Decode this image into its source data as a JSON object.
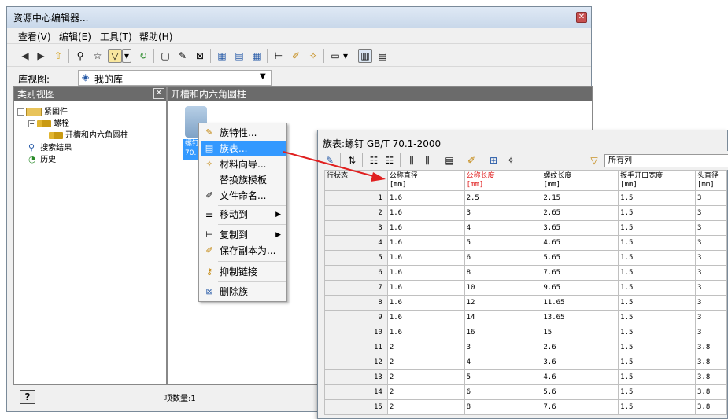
{
  "main_window": {
    "title": "资源中心编辑器...",
    "menu": [
      "查看(V)",
      "编辑(E)",
      "工具(T)",
      "帮助(H)"
    ],
    "library_label": "库视图:",
    "library_value": "我的库",
    "tree_panel_title": "类别视图",
    "content_panel_title": "开槽和内六角圆柱",
    "tree": [
      {
        "label": "紧固件",
        "level": 0,
        "expander": "⊟"
      },
      {
        "label": "螺栓",
        "level": 1,
        "expander": "⊟"
      },
      {
        "label": "开槽和内六角圆柱",
        "level": 2,
        "expander": ""
      },
      {
        "label": "搜索结果",
        "level": 0,
        "expander": ""
      },
      {
        "label": "历史",
        "level": 0,
        "expander": ""
      }
    ],
    "item_caption": [
      "螺钉",
      "70."
    ],
    "status": "项数量:1",
    "help_button": "?"
  },
  "context_menu": {
    "items": [
      {
        "label": "族特性...",
        "icon": "family-properties-icon",
        "submenu": false
      },
      {
        "label": "族表...",
        "icon": "family-table-icon",
        "submenu": false,
        "selected": true
      },
      {
        "label": "材料向导...",
        "icon": "material-wizard-icon",
        "submenu": false
      },
      {
        "label": "替换族模板",
        "icon": "",
        "submenu": false
      },
      {
        "label": "文件命名...",
        "icon": "file-naming-icon",
        "submenu": false
      },
      {
        "label": "移动到",
        "icon": "move-to-icon",
        "submenu": true
      },
      {
        "label": "复制到",
        "icon": "copy-to-icon",
        "submenu": true
      },
      {
        "label": "保存副本为...",
        "icon": "save-copy-icon",
        "submenu": false
      },
      {
        "label": "抑制链接",
        "icon": "suppress-link-icon",
        "submenu": false
      },
      {
        "label": "删除族",
        "icon": "delete-family-icon",
        "submenu": false
      }
    ]
  },
  "family_table": {
    "title": "族表:螺钉 GB/T 70.1-2000",
    "filter_value": "所有列",
    "columns": [
      {
        "name": "行状态",
        "unit": ""
      },
      {
        "name": "公称直径",
        "unit": "[mm]",
        "required": false
      },
      {
        "name": "公称长度",
        "unit": "[mm]",
        "required": true
      },
      {
        "name": "螺纹长度",
        "unit": "[mm]",
        "required": false
      },
      {
        "name": "扳手开口宽度",
        "unit": "[mm]",
        "required": false
      },
      {
        "name": "头直径",
        "unit": "[mm]",
        "required": false
      }
    ],
    "rows": [
      [
        "1",
        "1.6",
        "2.5",
        "2.15",
        "1.5",
        "3"
      ],
      [
        "2",
        "1.6",
        "3",
        "2.65",
        "1.5",
        "3"
      ],
      [
        "3",
        "1.6",
        "4",
        "3.65",
        "1.5",
        "3"
      ],
      [
        "4",
        "1.6",
        "5",
        "4.65",
        "1.5",
        "3"
      ],
      [
        "5",
        "1.6",
        "6",
        "5.65",
        "1.5",
        "3"
      ],
      [
        "6",
        "1.6",
        "8",
        "7.65",
        "1.5",
        "3"
      ],
      [
        "7",
        "1.6",
        "10",
        "9.65",
        "1.5",
        "3"
      ],
      [
        "8",
        "1.6",
        "12",
        "11.65",
        "1.5",
        "3"
      ],
      [
        "9",
        "1.6",
        "14",
        "13.65",
        "1.5",
        "3"
      ],
      [
        "10",
        "1.6",
        "16",
        "15",
        "1.5",
        "3"
      ],
      [
        "11",
        "2",
        "3",
        "2.6",
        "1.5",
        "3.8"
      ],
      [
        "12",
        "2",
        "4",
        "3.6",
        "1.5",
        "3.8"
      ],
      [
        "13",
        "2",
        "5",
        "4.6",
        "1.5",
        "3.8"
      ],
      [
        "14",
        "2",
        "6",
        "5.6",
        "1.5",
        "3.8"
      ],
      [
        "15",
        "2",
        "8",
        "7.6",
        "1.5",
        "3.8"
      ]
    ]
  },
  "colors": {
    "selection": "#3399ff",
    "panel_header": "#6b6b6b",
    "arrow": "#e02020",
    "required_column": "#e02020"
  }
}
